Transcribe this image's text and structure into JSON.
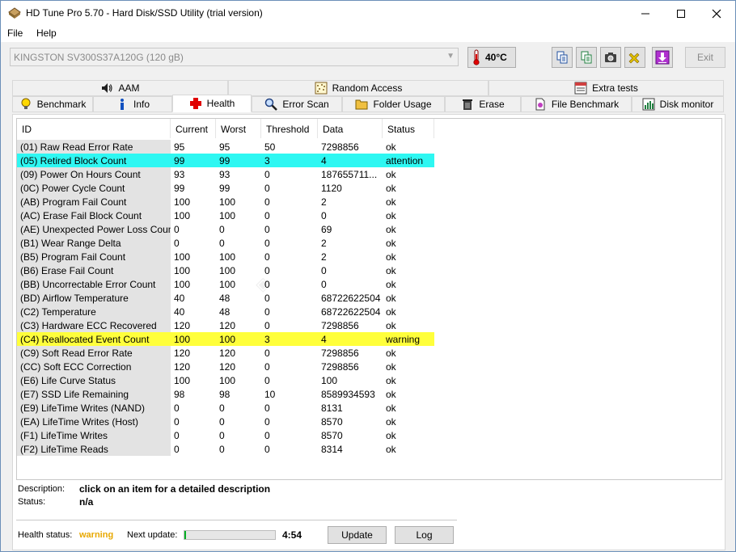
{
  "window": {
    "title": "HD Tune Pro 5.70 - Hard Disk/SSD Utility (trial version)",
    "min_icon": "minimize-icon",
    "max_icon": "maximize-icon",
    "close_icon": "close-icon"
  },
  "menu": {
    "file": "File",
    "help": "Help"
  },
  "toolbar": {
    "drive": "KINGSTON SV300S37A120G (120 gB)",
    "temperature": "40°C",
    "exit_label": "Exit"
  },
  "tabs_top": [
    {
      "label": "AAM"
    },
    {
      "label": "Random Access"
    },
    {
      "label": "Extra tests"
    }
  ],
  "tabs_bottom": [
    {
      "label": "Benchmark"
    },
    {
      "label": "Info"
    },
    {
      "label": "Health"
    },
    {
      "label": "Error Scan"
    },
    {
      "label": "Folder Usage"
    },
    {
      "label": "Erase"
    },
    {
      "label": "File Benchmark"
    },
    {
      "label": "Disk monitor"
    }
  ],
  "table": {
    "headers": [
      "ID",
      "Current",
      "Worst",
      "Threshold",
      "Data",
      "Status"
    ],
    "rows": [
      {
        "id": "(01) Raw Read Error Rate",
        "current": "95",
        "worst": "95",
        "threshold": "50",
        "data": "7298856",
        "status": "ok",
        "state": "normal"
      },
      {
        "id": "(05) Retired Block Count",
        "current": "99",
        "worst": "99",
        "threshold": "3",
        "data": "4",
        "status": "attention",
        "state": "attention"
      },
      {
        "id": "(09) Power On Hours Count",
        "current": "93",
        "worst": "93",
        "threshold": "0",
        "data": "187655711...",
        "status": "ok",
        "state": "normal"
      },
      {
        "id": "(0C) Power Cycle Count",
        "current": "99",
        "worst": "99",
        "threshold": "0",
        "data": "1120",
        "status": "ok",
        "state": "normal"
      },
      {
        "id": "(AB) Program Fail Count",
        "current": "100",
        "worst": "100",
        "threshold": "0",
        "data": "2",
        "status": "ok",
        "state": "normal"
      },
      {
        "id": "(AC) Erase Fail Block Count",
        "current": "100",
        "worst": "100",
        "threshold": "0",
        "data": "0",
        "status": "ok",
        "state": "normal"
      },
      {
        "id": "(AE) Unexpected Power Loss Count",
        "current": "0",
        "worst": "0",
        "threshold": "0",
        "data": "69",
        "status": "ok",
        "state": "normal"
      },
      {
        "id": "(B1) Wear Range Delta",
        "current": "0",
        "worst": "0",
        "threshold": "0",
        "data": "2",
        "status": "ok",
        "state": "normal"
      },
      {
        "id": "(B5) Program Fail Count",
        "current": "100",
        "worst": "100",
        "threshold": "0",
        "data": "2",
        "status": "ok",
        "state": "normal"
      },
      {
        "id": "(B6) Erase Fail Count",
        "current": "100",
        "worst": "100",
        "threshold": "0",
        "data": "0",
        "status": "ok",
        "state": "normal"
      },
      {
        "id": "(BB) Uncorrectable Error Count",
        "current": "100",
        "worst": "100",
        "threshold": "0",
        "data": "0",
        "status": "ok",
        "state": "normal"
      },
      {
        "id": "(BD) Airflow Temperature",
        "current": "40",
        "worst": "48",
        "threshold": "0",
        "data": "68722622504",
        "status": "ok",
        "state": "normal"
      },
      {
        "id": "(C2) Temperature",
        "current": "40",
        "worst": "48",
        "threshold": "0",
        "data": "68722622504",
        "status": "ok",
        "state": "normal"
      },
      {
        "id": "(C3) Hardware ECC Recovered",
        "current": "120",
        "worst": "120",
        "threshold": "0",
        "data": "7298856",
        "status": "ok",
        "state": "normal"
      },
      {
        "id": "(C4) Reallocated Event Count",
        "current": "100",
        "worst": "100",
        "threshold": "3",
        "data": "4",
        "status": "warning",
        "state": "warning"
      },
      {
        "id": "(C9) Soft Read Error Rate",
        "current": "120",
        "worst": "120",
        "threshold": "0",
        "data": "7298856",
        "status": "ok",
        "state": "normal"
      },
      {
        "id": "(CC) Soft ECC Correction",
        "current": "120",
        "worst": "120",
        "threshold": "0",
        "data": "7298856",
        "status": "ok",
        "state": "normal"
      },
      {
        "id": "(E6) Life Curve Status",
        "current": "100",
        "worst": "100",
        "threshold": "0",
        "data": "100",
        "status": "ok",
        "state": "normal"
      },
      {
        "id": "(E7) SSD Life Remaining",
        "current": "98",
        "worst": "98",
        "threshold": "10",
        "data": "8589934593",
        "status": "ok",
        "state": "normal"
      },
      {
        "id": "(E9) LifeTime Writes (NAND)",
        "current": "0",
        "worst": "0",
        "threshold": "0",
        "data": "8131",
        "status": "ok",
        "state": "normal"
      },
      {
        "id": "(EA) LifeTime Writes (Host)",
        "current": "0",
        "worst": "0",
        "threshold": "0",
        "data": "8570",
        "status": "ok",
        "state": "normal"
      },
      {
        "id": "(F1) LifeTime Writes",
        "current": "0",
        "worst": "0",
        "threshold": "0",
        "data": "8570",
        "status": "ok",
        "state": "normal"
      },
      {
        "id": "(F2) LifeTime Reads",
        "current": "0",
        "worst": "0",
        "threshold": "0",
        "data": "8314",
        "status": "ok",
        "state": "normal"
      }
    ]
  },
  "details": {
    "description_label": "Description:",
    "description_value": "click on an item for a detailed description",
    "status_label": "Status:",
    "status_value": "n/a"
  },
  "footer": {
    "health_label": "Health status:",
    "health_value": "warning",
    "next_update_label": "Next update:",
    "progress_fraction": 0.02,
    "countdown": "4:54",
    "update_label": "Update",
    "log_label": "Log"
  },
  "colors": {
    "attention": "#2ef7f2",
    "warning": "#ffff3b",
    "health_warning_text": "#e8a800",
    "progress_fill": "#06b025"
  }
}
